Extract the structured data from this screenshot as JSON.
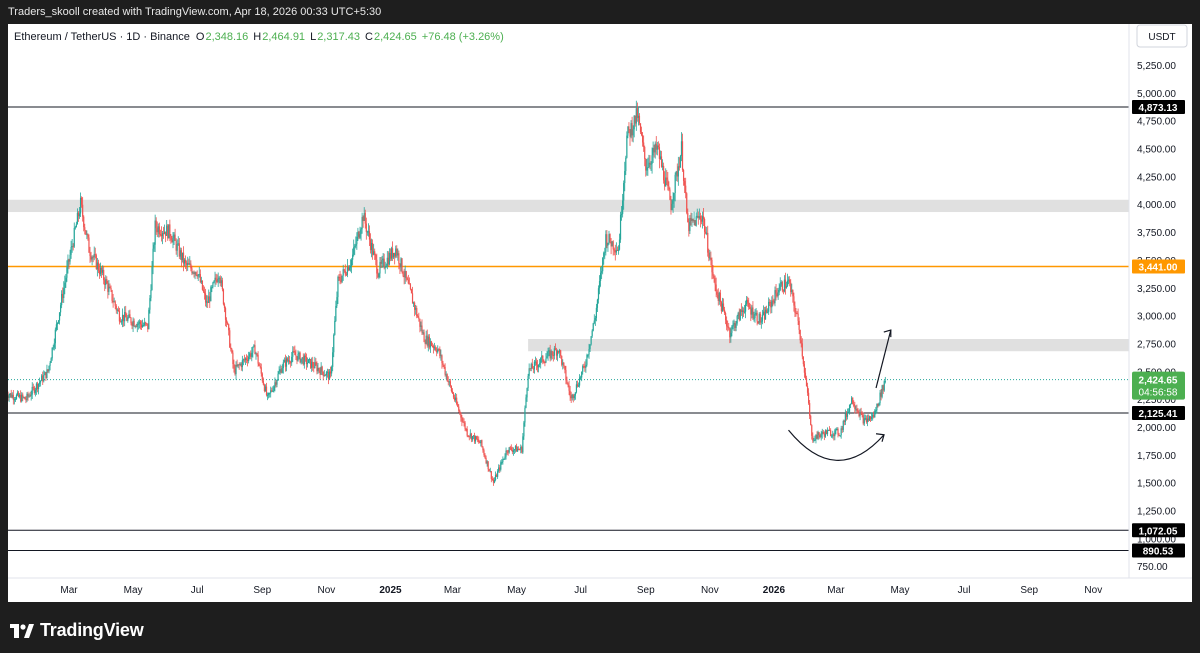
{
  "header": {
    "attribution": "Traders_skooll created with TradingView.com, Apr 18, 2026 00:33 UTC+5:30"
  },
  "legend": {
    "symbol": "Ethereum / TetherUS · 1D · Binance",
    "open_label": "O",
    "open": "2,348.16",
    "high_label": "H",
    "high": "2,464.91",
    "low_label": "L",
    "low": "2,317.43",
    "close_label": "C",
    "close": "2,424.65",
    "change": "+76.48 (+3.26%)"
  },
  "currency_button": "USDT",
  "footer": {
    "brand": "TradingView"
  },
  "colors": {
    "up": "#26a69a",
    "down": "#ef5350",
    "orange": "#ff9800",
    "green": "#4caf50",
    "zone": "#e0e0e0",
    "line": "#131722"
  },
  "chart_data": {
    "type": "candlestick",
    "symbol": "ETHUSDT",
    "timeframe": "1D",
    "exchange": "Binance",
    "ylim": [
      600,
      5500
    ],
    "y_ticks": [
      {
        "value": 5250,
        "label": "5,250.00"
      },
      {
        "value": 5000,
        "label": "5,000.00"
      },
      {
        "value": 4750,
        "label": "4,750.00"
      },
      {
        "value": 4500,
        "label": "4,500.00"
      },
      {
        "value": 4250,
        "label": "4,250.00"
      },
      {
        "value": 4000,
        "label": "4,000.00"
      },
      {
        "value": 3750,
        "label": "3,750.00"
      },
      {
        "value": 3500,
        "label": "3,500.00"
      },
      {
        "value": 3250,
        "label": "3,250.00"
      },
      {
        "value": 3000,
        "label": "3,000.00"
      },
      {
        "value": 2750,
        "label": "2,750.00"
      },
      {
        "value": 2500,
        "label": "2,500.00"
      },
      {
        "value": 2250,
        "label": "2,250.00"
      },
      {
        "value": 2000,
        "label": "2,000.00"
      },
      {
        "value": 1750,
        "label": "1,750.00"
      },
      {
        "value": 1500,
        "label": "1,500.00"
      },
      {
        "value": 1250,
        "label": "1,250.00"
      },
      {
        "value": 1000,
        "label": "1,000.00"
      },
      {
        "value": 750,
        "label": "750.00"
      }
    ],
    "x_ticks": [
      {
        "date": "2024-03-01",
        "label": "Mar",
        "bold": false
      },
      {
        "date": "2024-05-01",
        "label": "May",
        "bold": false
      },
      {
        "date": "2024-07-01",
        "label": "Jul",
        "bold": false
      },
      {
        "date": "2024-09-01",
        "label": "Sep",
        "bold": false
      },
      {
        "date": "2024-11-01",
        "label": "Nov",
        "bold": false
      },
      {
        "date": "2025-01-01",
        "label": "2025",
        "bold": true
      },
      {
        "date": "2025-03-01",
        "label": "Mar",
        "bold": false
      },
      {
        "date": "2025-05-01",
        "label": "May",
        "bold": false
      },
      {
        "date": "2025-07-01",
        "label": "Jul",
        "bold": false
      },
      {
        "date": "2025-09-01",
        "label": "Sep",
        "bold": false
      },
      {
        "date": "2025-11-01",
        "label": "Nov",
        "bold": false
      },
      {
        "date": "2026-01-01",
        "label": "2026",
        "bold": true
      },
      {
        "date": "2026-03-01",
        "label": "Mar",
        "bold": false
      },
      {
        "date": "2026-05-01",
        "label": "May",
        "bold": false
      },
      {
        "date": "2026-07-01",
        "label": "Jul",
        "bold": false
      },
      {
        "date": "2026-09-01",
        "label": "Sep",
        "bold": false
      },
      {
        "date": "2026-11-01",
        "label": "Nov",
        "bold": false
      }
    ],
    "price_path": [
      [
        "2024-01-01",
        2300
      ],
      [
        "2024-01-20",
        2250
      ],
      [
        "2024-02-10",
        2500
      ],
      [
        "2024-02-28",
        3400
      ],
      [
        "2024-03-12",
        4000
      ],
      [
        "2024-03-20",
        3600
      ],
      [
        "2024-04-05",
        3300
      ],
      [
        "2024-04-18",
        3000
      ],
      [
        "2024-05-01",
        2950
      ],
      [
        "2024-05-15",
        2900
      ],
      [
        "2024-05-22",
        3800
      ],
      [
        "2024-06-05",
        3750
      ],
      [
        "2024-06-20",
        3450
      ],
      [
        "2024-07-01",
        3400
      ],
      [
        "2024-07-10",
        3100
      ],
      [
        "2024-07-22",
        3400
      ],
      [
        "2024-08-05",
        2500
      ],
      [
        "2024-08-25",
        2700
      ],
      [
        "2024-09-06",
        2250
      ],
      [
        "2024-09-20",
        2550
      ],
      [
        "2024-10-01",
        2650
      ],
      [
        "2024-10-20",
        2550
      ],
      [
        "2024-11-05",
        2450
      ],
      [
        "2024-11-12",
        3300
      ],
      [
        "2024-11-25",
        3500
      ],
      [
        "2024-12-06",
        3900
      ],
      [
        "2024-12-20",
        3400
      ],
      [
        "2025-01-06",
        3600
      ],
      [
        "2025-01-20",
        3200
      ],
      [
        "2025-02-02",
        2800
      ],
      [
        "2025-02-15",
        2700
      ],
      [
        "2025-03-01",
        2300
      ],
      [
        "2025-03-15",
        1950
      ],
      [
        "2025-03-28",
        1850
      ],
      [
        "2025-04-09",
        1500
      ],
      [
        "2025-04-22",
        1800
      ],
      [
        "2025-05-06",
        1800
      ],
      [
        "2025-05-12",
        2500
      ],
      [
        "2025-05-25",
        2600
      ],
      [
        "2025-06-10",
        2700
      ],
      [
        "2025-06-22",
        2250
      ],
      [
        "2025-07-05",
        2550
      ],
      [
        "2025-07-15",
        3000
      ],
      [
        "2025-07-25",
        3700
      ],
      [
        "2025-08-06",
        3600
      ],
      [
        "2025-08-14",
        4600
      ],
      [
        "2025-08-24",
        4800
      ],
      [
        "2025-09-01",
        4350
      ],
      [
        "2025-09-12",
        4500
      ],
      [
        "2025-09-25",
        4000
      ],
      [
        "2025-10-05",
        4500
      ],
      [
        "2025-10-11",
        3800
      ],
      [
        "2025-10-25",
        3900
      ],
      [
        "2025-11-05",
        3300
      ],
      [
        "2025-11-20",
        2850
      ],
      [
        "2025-12-05",
        3100
      ],
      [
        "2025-12-20",
        2950
      ],
      [
        "2026-01-06",
        3250
      ],
      [
        "2026-01-15",
        3300
      ],
      [
        "2026-01-25",
        2900
      ],
      [
        "2026-02-03",
        2200
      ],
      [
        "2026-02-06",
        1900
      ],
      [
        "2026-02-20",
        1950
      ],
      [
        "2026-03-05",
        1950
      ],
      [
        "2026-03-16",
        2250
      ],
      [
        "2026-03-28",
        2050
      ],
      [
        "2026-04-06",
        2100
      ],
      [
        "2026-04-17",
        2424.65
      ]
    ],
    "horizontal_lines": [
      {
        "value": 4873.13,
        "label": "4,873.13",
        "color": "#131722"
      },
      {
        "value": 3441.0,
        "label": "3,441.00",
        "color": "#ff9800"
      },
      {
        "value": 2125.41,
        "label": "2,125.41",
        "color": "#131722"
      },
      {
        "value": 1072.05,
        "label": "1,072.05",
        "color": "#131722"
      },
      {
        "value": 890.53,
        "label": "890.53",
        "color": "#131722"
      }
    ],
    "zones": [
      {
        "from": 3930,
        "to": 4040,
        "start": "2024-01-01"
      },
      {
        "from": 2680,
        "to": 2790,
        "start": "2025-05-12"
      }
    ],
    "current_price": {
      "value": 2424.65,
      "label": "2,424.65",
      "countdown": "04:56:58"
    },
    "annotations": [
      {
        "type": "curve",
        "desc": "rounded bottom",
        "from": [
          "2026-02-01",
          1900
        ],
        "to": [
          "2026-04-12",
          1930
        ]
      },
      {
        "type": "arrow",
        "from": [
          "2026-04-12",
          2350
        ],
        "to": [
          "2026-04-27",
          2870
        ]
      }
    ]
  }
}
